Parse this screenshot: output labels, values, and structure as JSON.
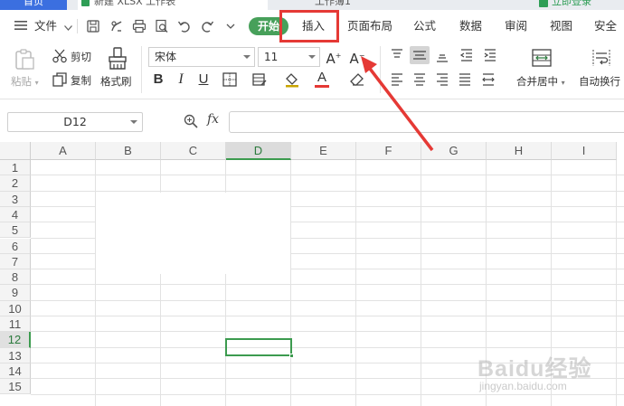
{
  "tabstrip": {
    "home_tab": "首页",
    "doc_tab_1": "新建 XLSX 工作表",
    "doc_tab_2": "工作簿1",
    "login_label": "立即登录"
  },
  "menubar": {
    "file_label": "文件",
    "tabs": [
      {
        "label": "开始",
        "active": true
      },
      {
        "label": "插入",
        "highlighted": true
      },
      {
        "label": "页面布局"
      },
      {
        "label": "公式"
      },
      {
        "label": "数据"
      },
      {
        "label": "审阅"
      },
      {
        "label": "视图"
      },
      {
        "label": "安全"
      }
    ]
  },
  "toolbar": {
    "paste_label": "粘贴",
    "cut_label": "剪切",
    "copy_label": "复制",
    "format_painter_label": "格式刷",
    "font_name": "宋体",
    "font_size": "11",
    "merge_center_label": "合并居中",
    "auto_wrap_label": "自动换行"
  },
  "formula_bar": {
    "name_box": "D12",
    "fx_label": "fx",
    "formula_value": ""
  },
  "grid": {
    "columns": [
      "A",
      "B",
      "C",
      "D",
      "E",
      "F",
      "G",
      "H",
      "I"
    ],
    "rows": [
      "1",
      "2",
      "3",
      "4",
      "5",
      "6",
      "7",
      "8",
      "9",
      "10",
      "11",
      "12",
      "13",
      "14",
      "15"
    ],
    "active_column": "D",
    "active_row": "12",
    "selected_cell": "D12"
  },
  "watermark": {
    "main": "Baidu经验",
    "sub": "jingyan.baidu.com"
  },
  "colors": {
    "accent_green": "#3c9b4f",
    "annotation_red": "#e53935",
    "home_tab_blue": "#3b6fe0"
  }
}
